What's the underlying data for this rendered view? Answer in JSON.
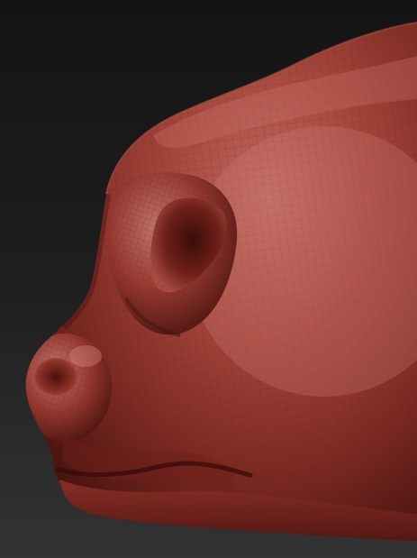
{
  "scene": {
    "subject": "sculpted-nose-head-model",
    "colors": {
      "background_top": "#141414",
      "background_bottom": "#333333",
      "clay_base": "#8a2f28",
      "clay_highlight": "#c9736a",
      "clay_shadow": "#3a0f0c",
      "wire": "#5a1a15"
    }
  }
}
